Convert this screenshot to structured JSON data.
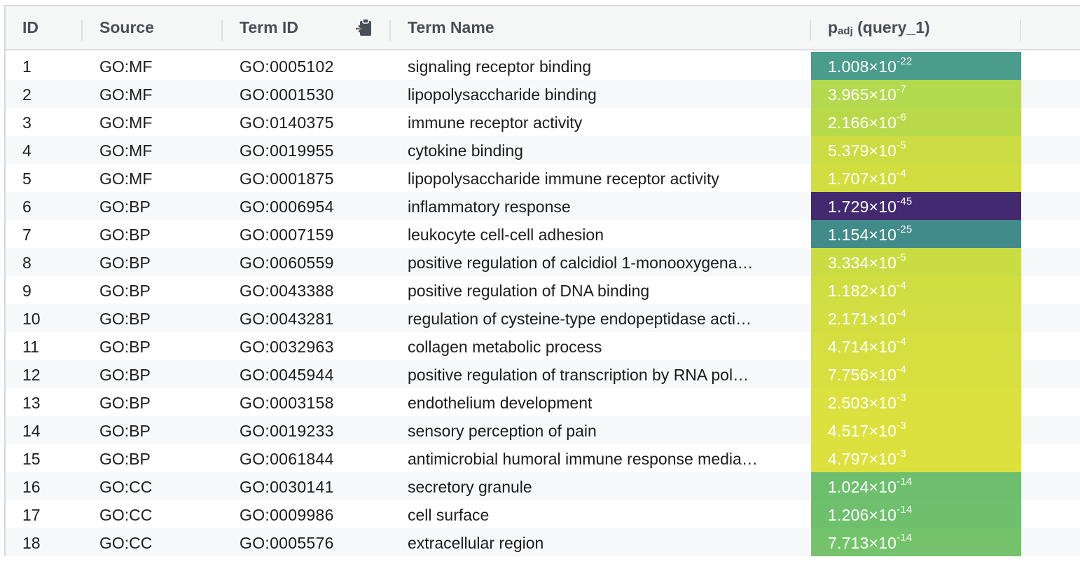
{
  "table": {
    "headers": {
      "id": "ID",
      "source": "Source",
      "term_id": "Term ID",
      "term_name": "Term Name",
      "padj_main": "p",
      "padj_sub": "adj",
      "padj_query": " (query_1)"
    },
    "rows": [
      {
        "id": "1",
        "source": "GO:MF",
        "term_id": "GO:0005102",
        "term_name": "signaling receptor binding",
        "padj_mantissa": "1.008×10",
        "padj_exp": "-22",
        "color": "#4a9c8c"
      },
      {
        "id": "2",
        "source": "GO:MF",
        "term_id": "GO:0001530",
        "term_name": "lipopolysaccharide binding",
        "padj_mantissa": "3.965×10",
        "padj_exp": "-7",
        "color": "#b3d94e"
      },
      {
        "id": "3",
        "source": "GO:MF",
        "term_id": "GO:0140375",
        "term_name": "immune receptor activity",
        "padj_mantissa": "2.166×10",
        "padj_exp": "-6",
        "color": "#b8da4a"
      },
      {
        "id": "4",
        "source": "GO:MF",
        "term_id": "GO:0019955",
        "term_name": "cytokine binding",
        "padj_mantissa": "5.379×10",
        "padj_exp": "-5",
        "color": "#cbdd42"
      },
      {
        "id": "5",
        "source": "GO:MF",
        "term_id": "GO:0001875",
        "term_name": "lipopolysaccharide immune receptor activity",
        "padj_mantissa": "1.707×10",
        "padj_exp": "-4",
        "color": "#d2de40"
      },
      {
        "id": "6",
        "source": "GO:BP",
        "term_id": "GO:0006954",
        "term_name": "inflammatory response",
        "padj_mantissa": "1.729×10",
        "padj_exp": "-45",
        "color": "#432970"
      },
      {
        "id": "7",
        "source": "GO:BP",
        "term_id": "GO:0007159",
        "term_name": "leukocyte cell-cell adhesion",
        "padj_mantissa": "1.154×10",
        "padj_exp": "-25",
        "color": "#418b8a"
      },
      {
        "id": "8",
        "source": "GO:BP",
        "term_id": "GO:0060559",
        "term_name": "positive regulation of calcidiol 1-monooxygena…",
        "padj_mantissa": "3.334×10",
        "padj_exp": "-5",
        "color": "#c9dd43"
      },
      {
        "id": "9",
        "source": "GO:BP",
        "term_id": "GO:0043388",
        "term_name": "positive regulation of DNA binding",
        "padj_mantissa": "1.182×10",
        "padj_exp": "-4",
        "color": "#d0de41"
      },
      {
        "id": "10",
        "source": "GO:BP",
        "term_id": "GO:0043281",
        "term_name": "regulation of cysteine-type endopeptidase acti…",
        "padj_mantissa": "2.171×10",
        "padj_exp": "-4",
        "color": "#d3df40"
      },
      {
        "id": "11",
        "source": "GO:BP",
        "term_id": "GO:0032963",
        "term_name": "collagen metabolic process",
        "padj_mantissa": "4.714×10",
        "padj_exp": "-4",
        "color": "#d5df40"
      },
      {
        "id": "12",
        "source": "GO:BP",
        "term_id": "GO:0045944",
        "term_name": "positive regulation of transcription by RNA pol…",
        "padj_mantissa": "7.756×10",
        "padj_exp": "-4",
        "color": "#d7e03f"
      },
      {
        "id": "13",
        "source": "GO:BP",
        "term_id": "GO:0003158",
        "term_name": "endothelium development",
        "padj_mantissa": "2.503×10",
        "padj_exp": "-3",
        "color": "#dbe13f"
      },
      {
        "id": "14",
        "source": "GO:BP",
        "term_id": "GO:0019233",
        "term_name": "sensory perception of pain",
        "padj_mantissa": "4.517×10",
        "padj_exp": "-3",
        "color": "#dde13e"
      },
      {
        "id": "15",
        "source": "GO:BP",
        "term_id": "GO:0061844",
        "term_name": "antimicrobial humoral immune response media…",
        "padj_mantissa": "4.797×10",
        "padj_exp": "-3",
        "color": "#dde13e"
      },
      {
        "id": "16",
        "source": "GO:CC",
        "term_id": "GO:0030141",
        "term_name": "secretory granule",
        "padj_mantissa": "1.024×10",
        "padj_exp": "-14",
        "color": "#6dbf6e"
      },
      {
        "id": "17",
        "source": "GO:CC",
        "term_id": "GO:0009986",
        "term_name": "cell surface",
        "padj_mantissa": "1.206×10",
        "padj_exp": "-14",
        "color": "#6ec06d"
      },
      {
        "id": "18",
        "source": "GO:CC",
        "term_id": "GO:0005576",
        "term_name": "extracellular region",
        "padj_mantissa": "7.713×10",
        "padj_exp": "-14",
        "color": "#74c36b"
      }
    ]
  },
  "icons": {
    "copy": "clipboard-icon"
  }
}
